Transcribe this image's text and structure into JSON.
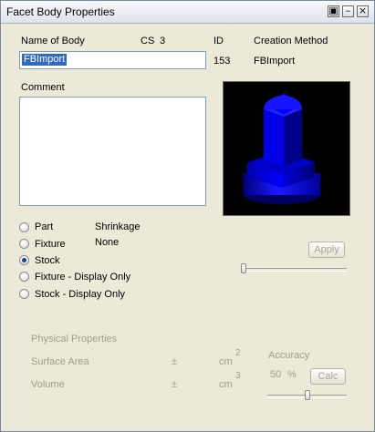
{
  "window": {
    "title": "Facet Body Properties"
  },
  "titlebar_buttons": [
    "help-icon",
    "minimize-icon",
    "close-icon"
  ],
  "header": {
    "name_label": "Name of Body",
    "cs_label": "CS",
    "cs_value": "3",
    "id_label": "ID",
    "id_value": "153",
    "creation_label": "Creation Method",
    "creation_value": "FBImport",
    "name_value": "FBImport"
  },
  "comment": {
    "label": "Comment",
    "value": ""
  },
  "radio_options": [
    {
      "label": "Part",
      "selected": false
    },
    {
      "label": "Fixture",
      "selected": false
    },
    {
      "label": "Stock",
      "selected": true
    },
    {
      "label": "Fixture - Display Only",
      "selected": false
    },
    {
      "label": "Stock - Display Only",
      "selected": false
    }
  ],
  "shrinkage": {
    "label": "Shrinkage",
    "value": "None"
  },
  "apply_button": "Apply",
  "transparency_slider": {
    "level": 0.0
  },
  "physical": {
    "section_label": "Physical Properties",
    "surface_area_label": "Surface Area",
    "volume_label": "Volume",
    "pm": "±",
    "unit": "cm",
    "sup_area": "2",
    "sup_volume": "3",
    "accuracy_label": "Accuracy",
    "accuracy_value": "50",
    "accuracy_unit": "%",
    "calc_button": "Calc",
    "accuracy_slider": {
      "level": 0.5
    }
  },
  "preview": {
    "background": "#000000",
    "body_color": "#0000ff"
  }
}
